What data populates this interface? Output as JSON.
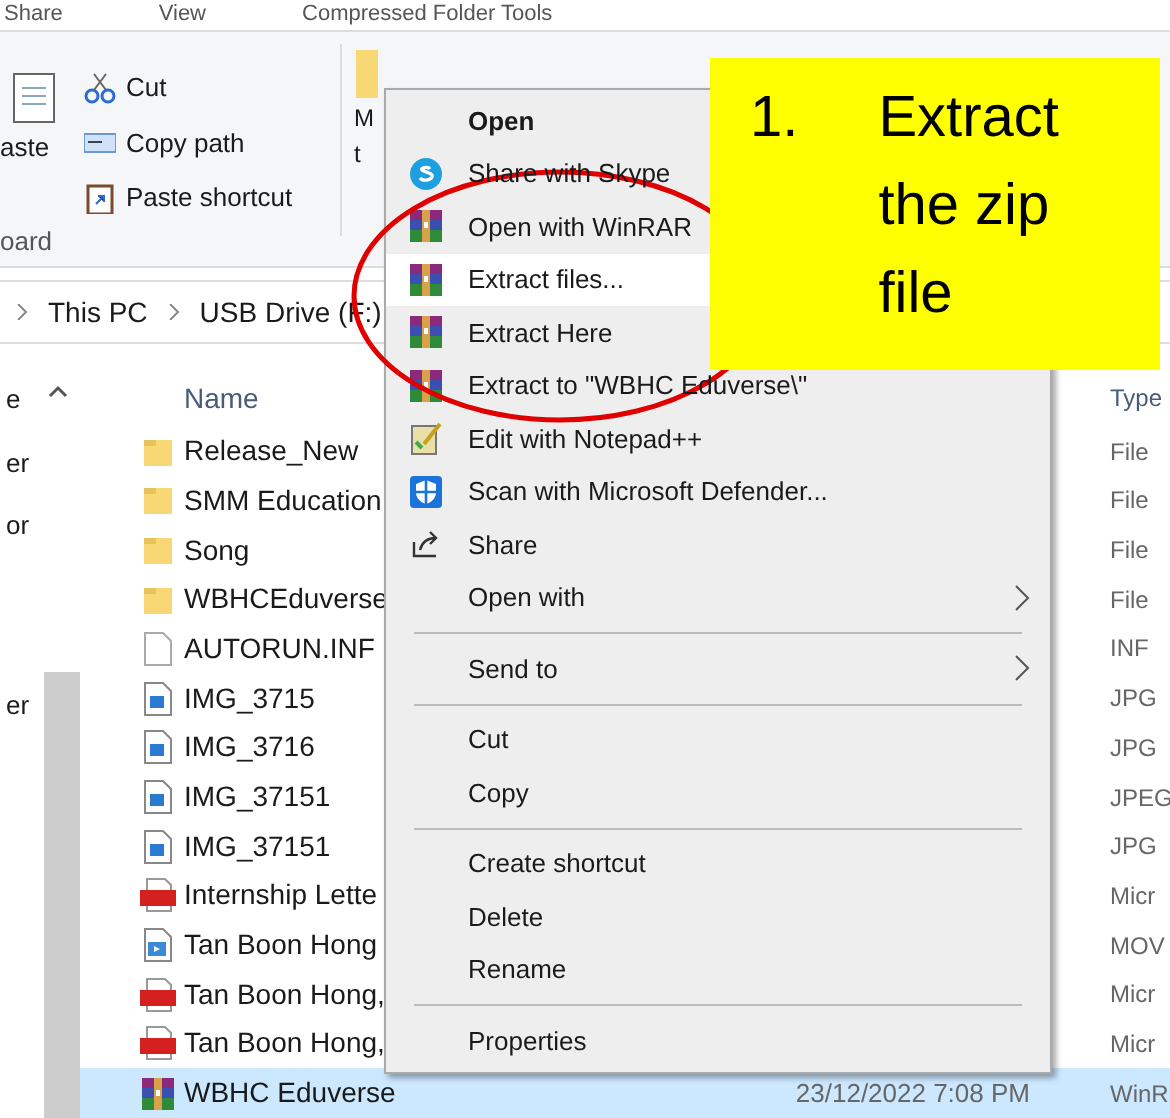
{
  "ribbon_tabs": [
    "Share",
    "View",
    "Compressed Folder Tools"
  ],
  "clipboard": {
    "paste_label": "aste",
    "group_label": "oard",
    "commands": [
      {
        "label": "Cut",
        "kind": "cut"
      },
      {
        "label": "Copy path",
        "kind": "path"
      },
      {
        "label": "Paste shortcut",
        "kind": "shortcut"
      }
    ]
  },
  "organize": {
    "move_label_1": "M",
    "move_label_2": "t"
  },
  "breadcrumb": [
    "This PC",
    "USB Drive (F:)"
  ],
  "nav_pane": [
    "e",
    "er",
    "or",
    "er"
  ],
  "columns": {
    "name": "Name",
    "type": "Type"
  },
  "files": [
    {
      "kind": "folder",
      "name": "Release_New",
      "type": "File",
      "selected": false
    },
    {
      "kind": "folder",
      "name": "SMM Education",
      "type": "File",
      "selected": false
    },
    {
      "kind": "folder",
      "name": "Song",
      "type": "File",
      "selected": false
    },
    {
      "kind": "folder",
      "name": "WBHCEduverse",
      "type": "File",
      "selected": false
    },
    {
      "kind": "file",
      "name": "AUTORUN.INF",
      "type": "INF",
      "selected": false
    },
    {
      "kind": "image",
      "name": "IMG_3715",
      "type": "JPG",
      "selected": false
    },
    {
      "kind": "image",
      "name": "IMG_3716",
      "type": "JPG",
      "selected": false
    },
    {
      "kind": "image",
      "name": "IMG_37151",
      "type": "JPEG",
      "selected": false
    },
    {
      "kind": "image",
      "name": "IMG_37151",
      "type": "JPG",
      "selected": false
    },
    {
      "kind": "pdf",
      "name": "Internship Lette",
      "type": "Micr",
      "selected": false
    },
    {
      "kind": "video",
      "name": "Tan Boon Hong",
      "type": "MOV",
      "selected": false
    },
    {
      "kind": "pdf",
      "name": "Tan Boon Hong,",
      "type": "Micr",
      "selected": false
    },
    {
      "kind": "pdf",
      "name": "Tan Boon Hong,",
      "type": "Micr",
      "selected": false
    },
    {
      "kind": "archive",
      "name": "WBHC Eduverse",
      "date": "23/12/2022 7:08 PM",
      "type": "WinR",
      "selected": true
    }
  ],
  "context_menu": [
    {
      "kind": "plain",
      "label": "Open",
      "default": true,
      "selected": false
    },
    {
      "kind": "chat",
      "label": "Share with Skype",
      "selected": false
    },
    {
      "kind": "archive",
      "label": "Open with WinRAR",
      "selected": false
    },
    {
      "kind": "archive",
      "label": "Extract files...",
      "selected": true
    },
    {
      "kind": "archive",
      "label": "Extract Here",
      "selected": false
    },
    {
      "kind": "archive",
      "label": "Extract to \"WBHC Eduverse\\\"",
      "selected": false
    },
    {
      "kind": "notepad",
      "label": "Edit with Notepad++",
      "selected": false
    },
    {
      "kind": "shield",
      "label": "Scan with Microsoft Defender...",
      "selected": false
    },
    {
      "kind": "share",
      "label": "Share",
      "selected": false
    },
    {
      "kind": "plain",
      "label": "Open with",
      "submenu": true,
      "selected": false
    },
    {
      "kind": "separator"
    },
    {
      "kind": "plain",
      "label": "Send to",
      "submenu": true,
      "selected": false
    },
    {
      "kind": "separator"
    },
    {
      "kind": "plain",
      "label": "Cut",
      "selected": false
    },
    {
      "kind": "plain",
      "label": "Copy",
      "selected": false
    },
    {
      "kind": "separator"
    },
    {
      "kind": "plain",
      "label": "Create shortcut",
      "selected": false
    },
    {
      "kind": "plain",
      "label": "Delete",
      "selected": false
    },
    {
      "kind": "plain",
      "label": "Rename",
      "selected": false
    },
    {
      "kind": "separator"
    },
    {
      "kind": "plain",
      "label": "Properties",
      "selected": false
    }
  ],
  "callout": {
    "number": "1.",
    "text": "Extract the zip file"
  }
}
